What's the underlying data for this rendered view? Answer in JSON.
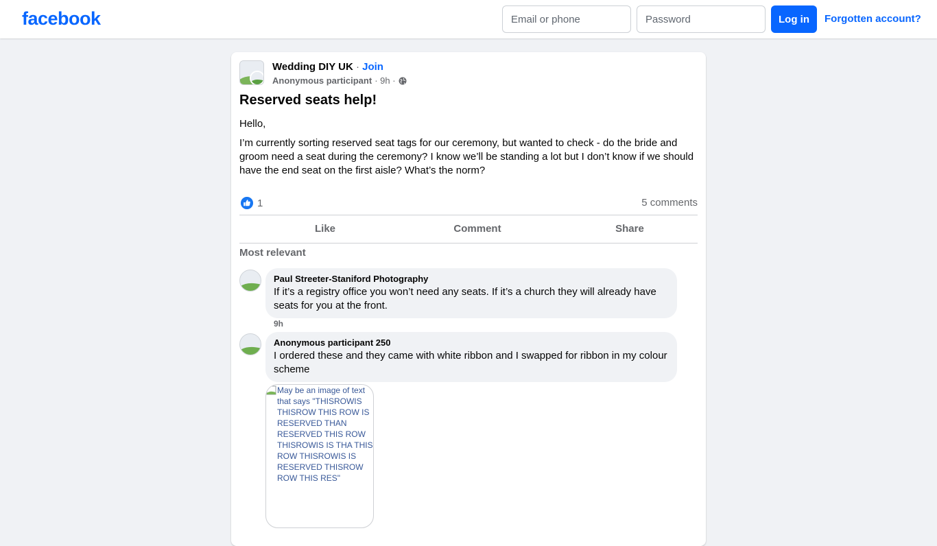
{
  "header": {
    "logo": "facebook",
    "email_placeholder": "Email or phone",
    "password_placeholder": "Password",
    "login_label": "Log in",
    "forgot_label": "Forgotten account?"
  },
  "post": {
    "group_name": "Wedding DIY UK",
    "join_sep": " · ",
    "join_label": "Join",
    "author": "Anonymous participant",
    "time": "· 9h ·",
    "title": "Reserved seats help!",
    "body": [
      "Hello,",
      "I’m currently sorting reserved seat tags for our ceremony, but wanted to check - do the bride and groom need a seat during the ceremony? I know we’ll be standing a lot but I don’t know if we should have the end seat on the first aisle? What’s the norm?"
    ],
    "like_count": "1",
    "comment_count": "5 comments"
  },
  "actions": {
    "like": "Like",
    "comment": "Comment",
    "share": "Share"
  },
  "comments_sort": "Most relevant",
  "comments": [
    {
      "author": "Paul Streeter-Staniford Photography",
      "text": "If it’s a registry office you won’t need any seats. If it’s a church they will already have seats for you at the front.",
      "time": "9h"
    },
    {
      "author": "Anonymous participant 250",
      "text": "I ordered these and they came with white ribbon and I swapped for ribbon in my colour scheme",
      "image_alt": "May be an image of text that says \"THISROWIS THISROW THIS ROW IS RESERVED THAN RESERVED THIS ROW THISROWIS IS THA THIS ROW THISROWIS IS RESERVED THISROW ROW THIS RES\""
    }
  ],
  "colors": {
    "brand": "#0866ff",
    "background": "#f0f2f5",
    "secondary_text": "#65676b"
  }
}
